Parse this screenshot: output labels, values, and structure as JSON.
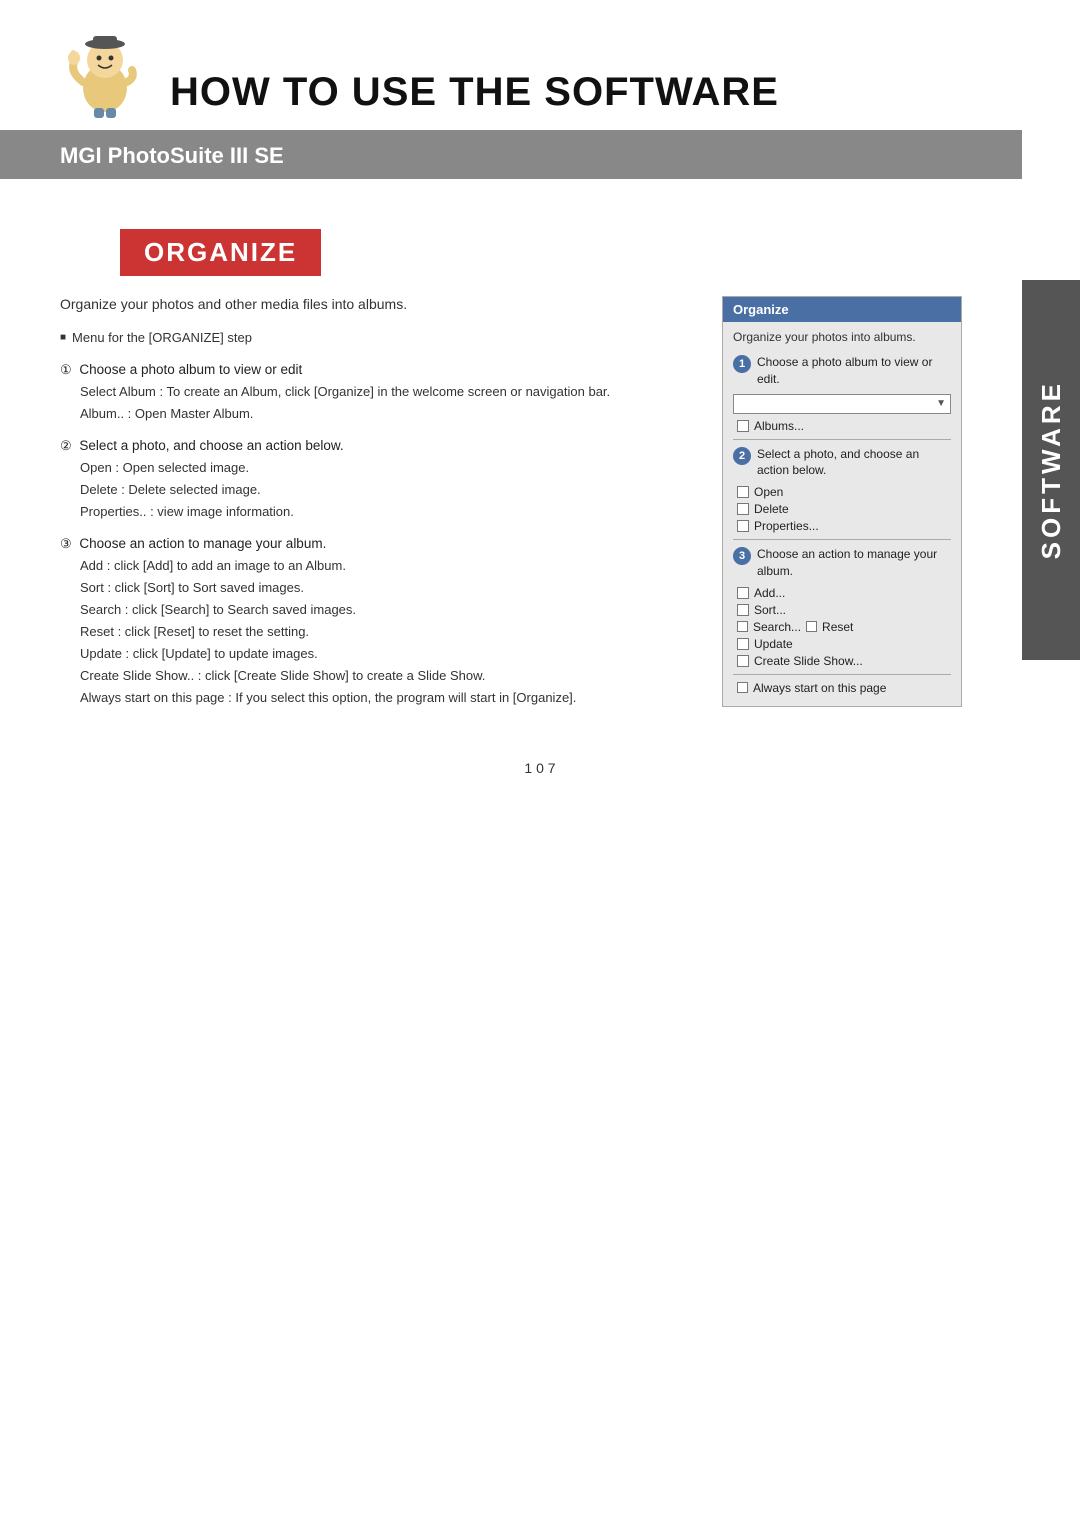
{
  "header": {
    "title": "HOW TO USE THE SOFTWARE",
    "subtitle": "MGI PhotoSuite III SE"
  },
  "sidebar": {
    "label": "SOFTWARE"
  },
  "organize": {
    "section_title": "ORGANIZE",
    "intro": "Organize your photos and other media files into albums.",
    "menu_label": "Menu for the [ORGANIZE] step",
    "steps": [
      {
        "number": "①",
        "text": "Choose a photo album to view or edit",
        "subs": [
          "Select Album : To create an Album, click [Organize] in the welcome screen or navigation bar.",
          "Album.. : Open Master Album."
        ]
      },
      {
        "number": "②",
        "text": "Select a photo, and choose an action below.",
        "subs": [
          "Open : Open selected image.",
          "Delete : Delete selected image.",
          "Properties.. : view image information."
        ]
      },
      {
        "number": "③",
        "text": "Choose an action to manage your album.",
        "subs": [
          "Add : click [Add] to add an image to an Album.",
          "Sort : click [Sort] to Sort saved images.",
          "Search : click [Search] to Search saved images.",
          "Reset : click [Reset] to reset the setting.",
          "Update : click [Update] to update images.",
          "Create Slide Show.. : click [Create Slide Show] to create a Slide Show.",
          "Always start on this page : If you select this option, the program will start in [Organize]."
        ]
      }
    ]
  },
  "ui_panel": {
    "title": "Organize",
    "intro": "Organize your photos into albums.",
    "step1_text": "Choose a photo album to view or edit.",
    "albums_label": "Albums...",
    "step2_text": "Select a photo, and choose an action below.",
    "open_label": "Open",
    "delete_label": "Delete",
    "properties_label": "Properties...",
    "step3_text": "Choose an action to manage your album.",
    "add_label": "Add...",
    "sort_label": "Sort...",
    "search_label": "Search...",
    "reset_label": "Reset",
    "update_label": "Update",
    "create_slide_label": "Create Slide Show...",
    "always_start_label": "Always start on this page"
  },
  "page_number": "1 0 7"
}
